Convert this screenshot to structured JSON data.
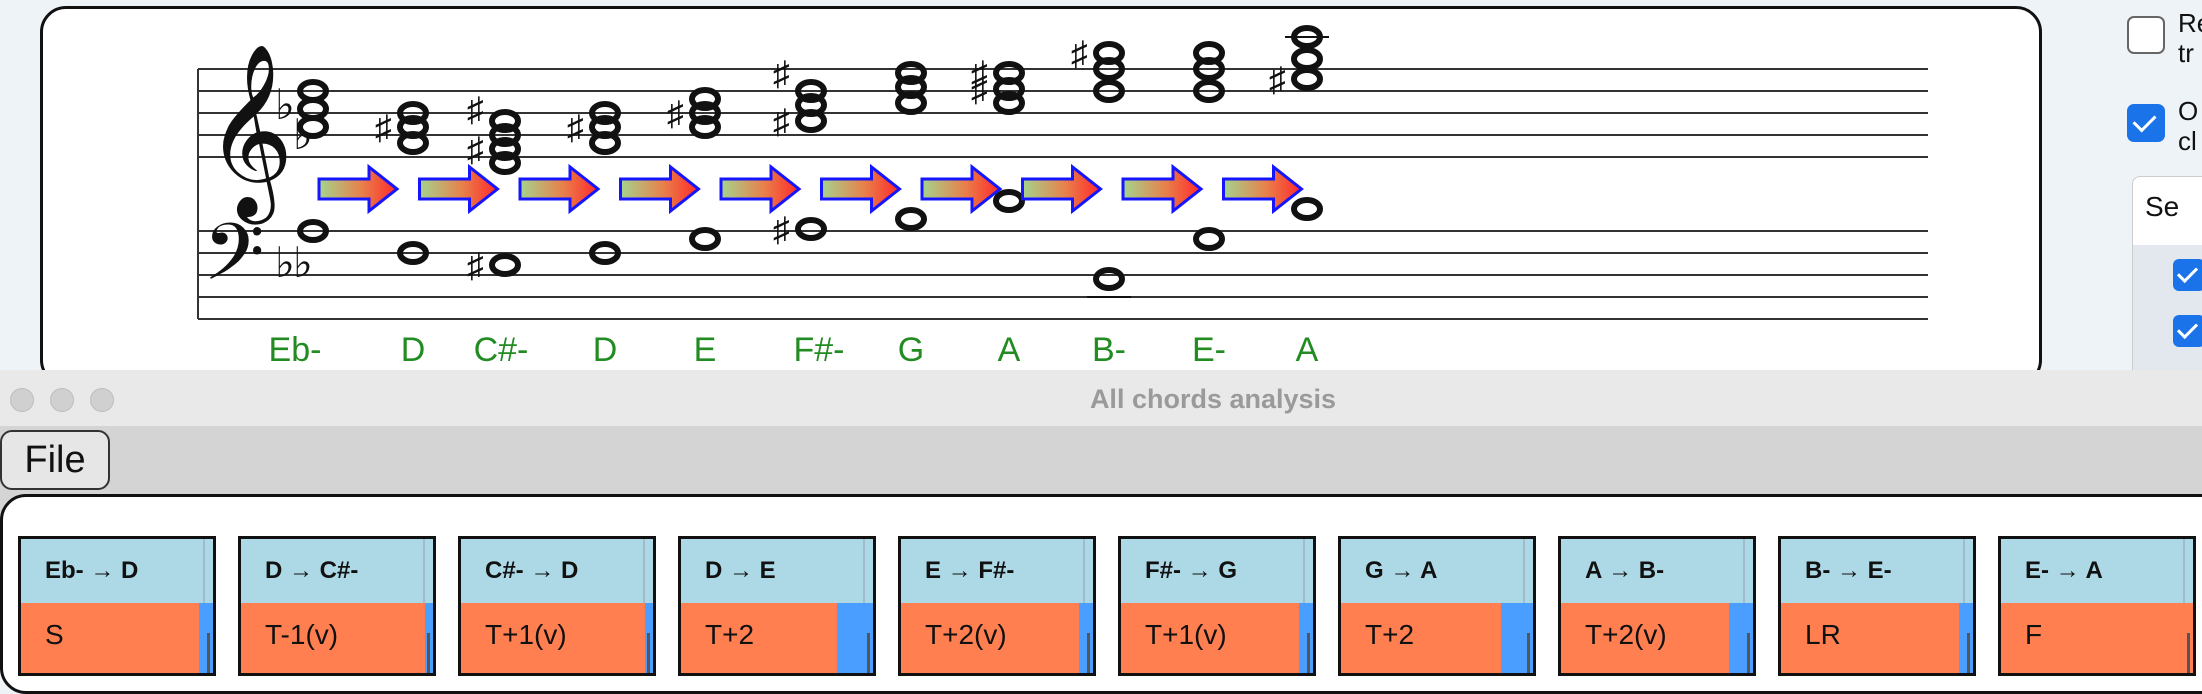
{
  "score": {
    "chord_labels": [
      "Eb-",
      "D",
      "C#-",
      "D",
      "E",
      "F#-",
      "G",
      "A",
      "B-",
      "E-",
      "A"
    ],
    "label_color": "#228b22",
    "arrow_count": 10
  },
  "controls": {
    "option1_text": [
      "Re",
      "tr"
    ],
    "option1_checked": false,
    "option2_text": [
      "O",
      "cl"
    ],
    "option2_checked": true,
    "selection_header": "Se",
    "accent": "#1a73e8"
  },
  "window": {
    "title": "All chords analysis",
    "menu_file": "File"
  },
  "transitions": [
    {
      "label": "Eb- → D",
      "op": "S",
      "fill": 0.07
    },
    {
      "label": "D → C#-",
      "op": "T-1(v)",
      "fill": 0.04
    },
    {
      "label": "C#- → D",
      "op": "T+1(v)",
      "fill": 0.04
    },
    {
      "label": "D → E",
      "op": "T+2",
      "fill": 0.18
    },
    {
      "label": "E → F#-",
      "op": "T+2(v)",
      "fill": 0.07
    },
    {
      "label": "F#- → G",
      "op": "T+1(v)",
      "fill": 0.07
    },
    {
      "label": "G → A",
      "op": "T+2",
      "fill": 0.16
    },
    {
      "label": "A → B-",
      "op": "T+2(v)",
      "fill": 0.12
    },
    {
      "label": "B- → E-",
      "op": "LR",
      "fill": 0.07
    },
    {
      "label": "E- → A",
      "op": "F",
      "fill": 0.0
    }
  ],
  "colors": {
    "header_bg": "#add8e6",
    "op_bg": "#ff7f50",
    "bar": "#4a9eff"
  }
}
